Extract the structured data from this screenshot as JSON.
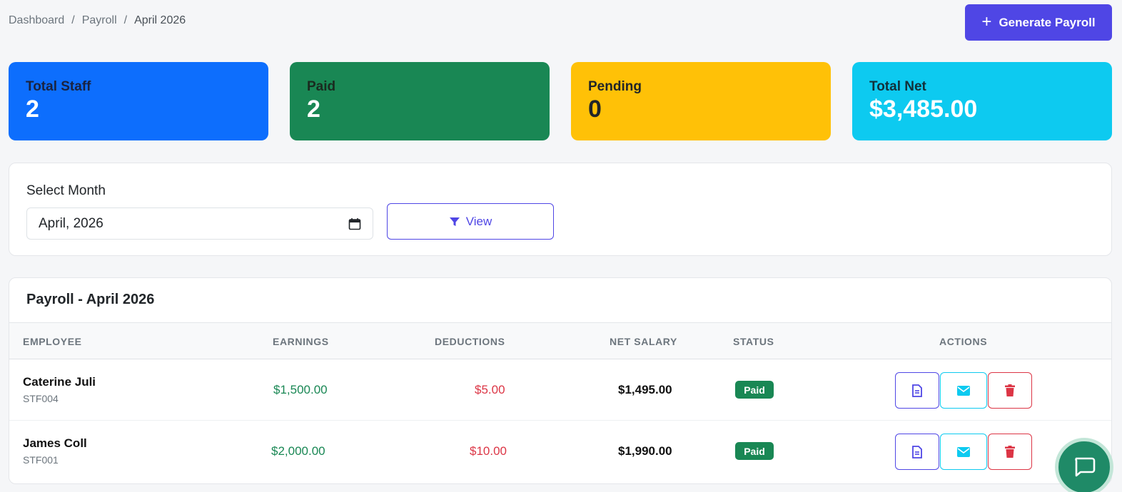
{
  "breadcrumb": {
    "items": [
      "Dashboard",
      "/",
      "Payroll",
      "/",
      "April 2026"
    ]
  },
  "header": {
    "generate_label": "Generate Payroll"
  },
  "stats": [
    {
      "label": "Total Staff",
      "value": "2",
      "color": "#0d6efd"
    },
    {
      "label": "Paid",
      "value": "2",
      "color": "#198754"
    },
    {
      "label": "Pending",
      "value": "0",
      "color": "#ffc107"
    },
    {
      "label": "Total Net",
      "value": "$3,485.00",
      "color": "#0dcaf0"
    }
  ],
  "filter": {
    "label": "Select Month",
    "month_value": "April, 2026",
    "view_label": "View",
    "view_icon": "filter-icon"
  },
  "table": {
    "title": "Payroll - April 2026",
    "columns": [
      "EMPLOYEE",
      "EARNINGS",
      "DEDUCTIONS",
      "NET SALARY",
      "STATUS",
      "ACTIONS"
    ],
    "rows": [
      {
        "name": "Caterine Juli",
        "code": "STF004",
        "earnings": "$1,500.00",
        "deductions": "$5.00",
        "net": "$1,495.00",
        "status": "Paid"
      },
      {
        "name": "James Coll",
        "code": "STF001",
        "earnings": "$2,000.00",
        "deductions": "$10.00",
        "net": "$1,990.00",
        "status": "Paid"
      }
    ],
    "action_icons": [
      "document-icon",
      "envelope-icon",
      "trash-icon"
    ]
  },
  "colors": {
    "accent": "#4f46e5",
    "success": "#198754",
    "danger": "#dc3545",
    "info": "#0dcaf0"
  }
}
